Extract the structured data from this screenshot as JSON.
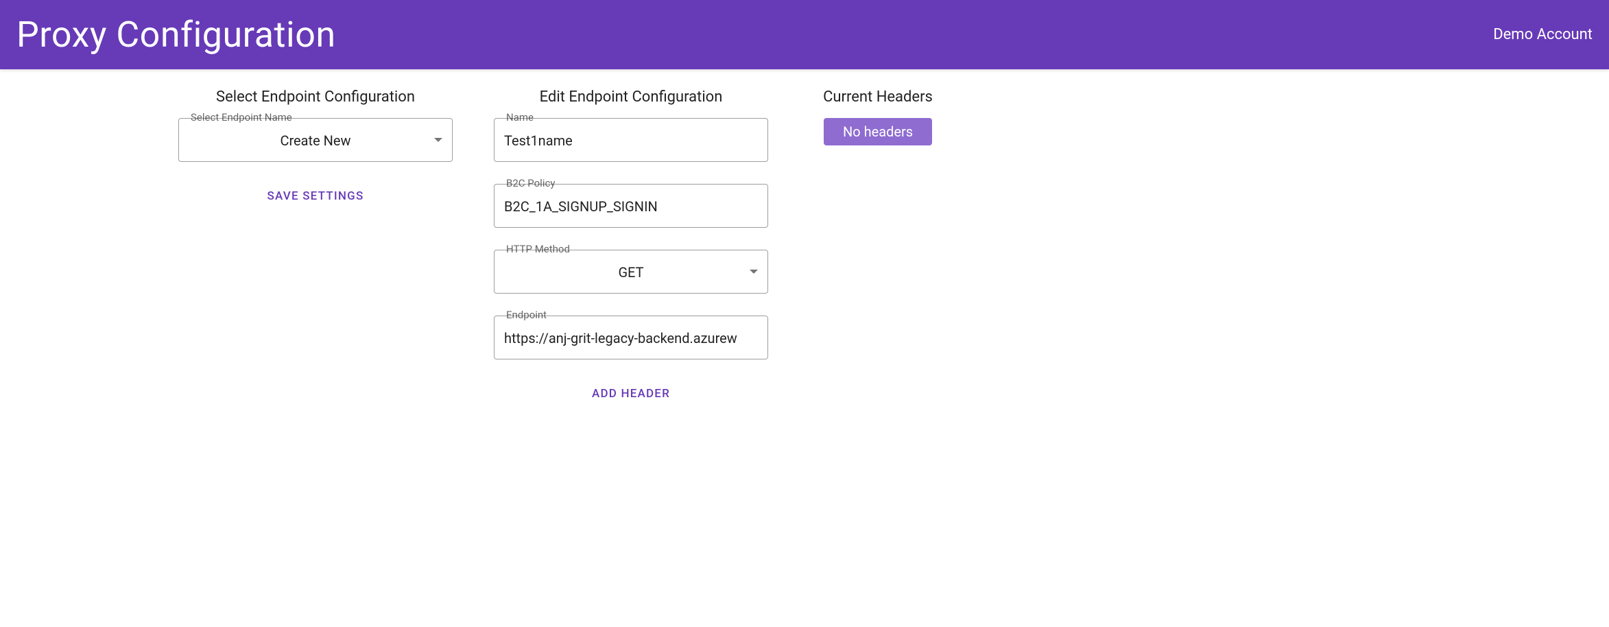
{
  "header": {
    "title": "Proxy Configuration",
    "account": "Demo Account"
  },
  "left": {
    "title": "Select Endpoint Configuration",
    "endpoint_name_label": "Select Endpoint Name",
    "endpoint_name_value": "Create New",
    "save_btn": "Save Settings"
  },
  "middle": {
    "title": "Edit Endpoint Configuration",
    "name_label": "Name",
    "name_value": "Test1name",
    "b2c_label": "B2C Policy",
    "b2c_value": "B2C_1A_SIGNUP_SIGNIN",
    "method_label": "HTTP Method",
    "method_value": "GET",
    "endpoint_label": "Endpoint",
    "endpoint_value": "https://anj-grit-legacy-backend.azurew",
    "add_header_btn": "Add Header"
  },
  "right": {
    "title": "Current Headers",
    "no_headers": "No headers"
  }
}
